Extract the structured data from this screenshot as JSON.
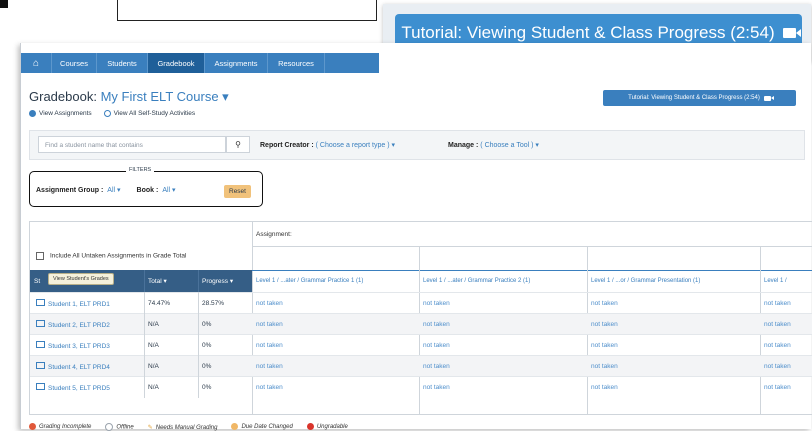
{
  "callout": {
    "label": "Tutorial: Viewing Student & Class Progress (2:54)",
    "icon": "video-camera-icon"
  },
  "nav": {
    "home_icon": "home-icon",
    "items": [
      "Courses",
      "Students",
      "Gradebook",
      "Assignments",
      "Resources"
    ],
    "active": "Gradebook"
  },
  "header": {
    "title_prefix": "Gradebook:",
    "course": "My First ELT Course",
    "tutorial_button": "Tutorial: Viewing Student & Class Progress (2:54)"
  },
  "view_options": [
    "View Assignments",
    "View All Self-Study Activities"
  ],
  "controls": {
    "search_placeholder": "Find a student name that contains",
    "report_creator_label": "Report Creator :",
    "report_creator_value": "( Choose a report type )",
    "manage_label": "Manage :",
    "manage_value": "( Choose a Tool )"
  },
  "filters": {
    "title": "FILTERS",
    "assignment_group_label": "Assignment Group :",
    "assignment_group_value": "All",
    "book_label": "Book :",
    "book_value": "All",
    "reset_label": "Reset"
  },
  "grid": {
    "include_label": "Include All Untaken Assignments in Grade Total",
    "assignment_label": "Assignment:",
    "tooltip": "View Student's Grades",
    "headers": {
      "student": "St",
      "total": "Total",
      "progress": "Progress"
    },
    "assignment_columns": [
      "Level 1 / ...ater / Grammar Practice 1 (1)",
      "Level 1 / ...ater / Grammar Practice 2 (1)",
      "Level 1 / ...or / Grammar Presentation (1)",
      "Level 1 /"
    ],
    "rows": [
      {
        "student": "Student 1, ELT PRD1",
        "total": "74.47%",
        "progress": "28.57%",
        "cells": [
          "not taken",
          "not taken",
          "not taken",
          "not taken"
        ]
      },
      {
        "student": "Student 2, ELT PRD2",
        "total": "N/A",
        "progress": "0%",
        "cells": [
          "not taken",
          "not taken",
          "not taken",
          "not taken"
        ]
      },
      {
        "student": "Student 3, ELT PRD3",
        "total": "N/A",
        "progress": "0%",
        "cells": [
          "not taken",
          "not taken",
          "not taken",
          "not taken"
        ]
      },
      {
        "student": "Student 4, ELT PRD4",
        "total": "N/A",
        "progress": "0%",
        "cells": [
          "not taken",
          "not taken",
          "not taken",
          "not taken"
        ]
      },
      {
        "student": "Student 5, ELT PRD5",
        "total": "N/A",
        "progress": "0%",
        "cells": [
          "not taken",
          "not taken",
          "not taken",
          "not taken"
        ]
      }
    ]
  },
  "legend": [
    {
      "label": "Grading Incomplete",
      "color": "#e0583a"
    },
    {
      "label": "Offline",
      "color": "#9aa3ad"
    },
    {
      "label": "Needs Manual Grading",
      "color": "#e2a33a"
    },
    {
      "label": "Due Date Changed",
      "color": "#f0b766"
    },
    {
      "label": "Ungradable",
      "color": "#d9342b"
    }
  ],
  "colors": {
    "accent": "#3a7fbe",
    "table_header": "#355e86",
    "reset": "#f1c27b"
  }
}
